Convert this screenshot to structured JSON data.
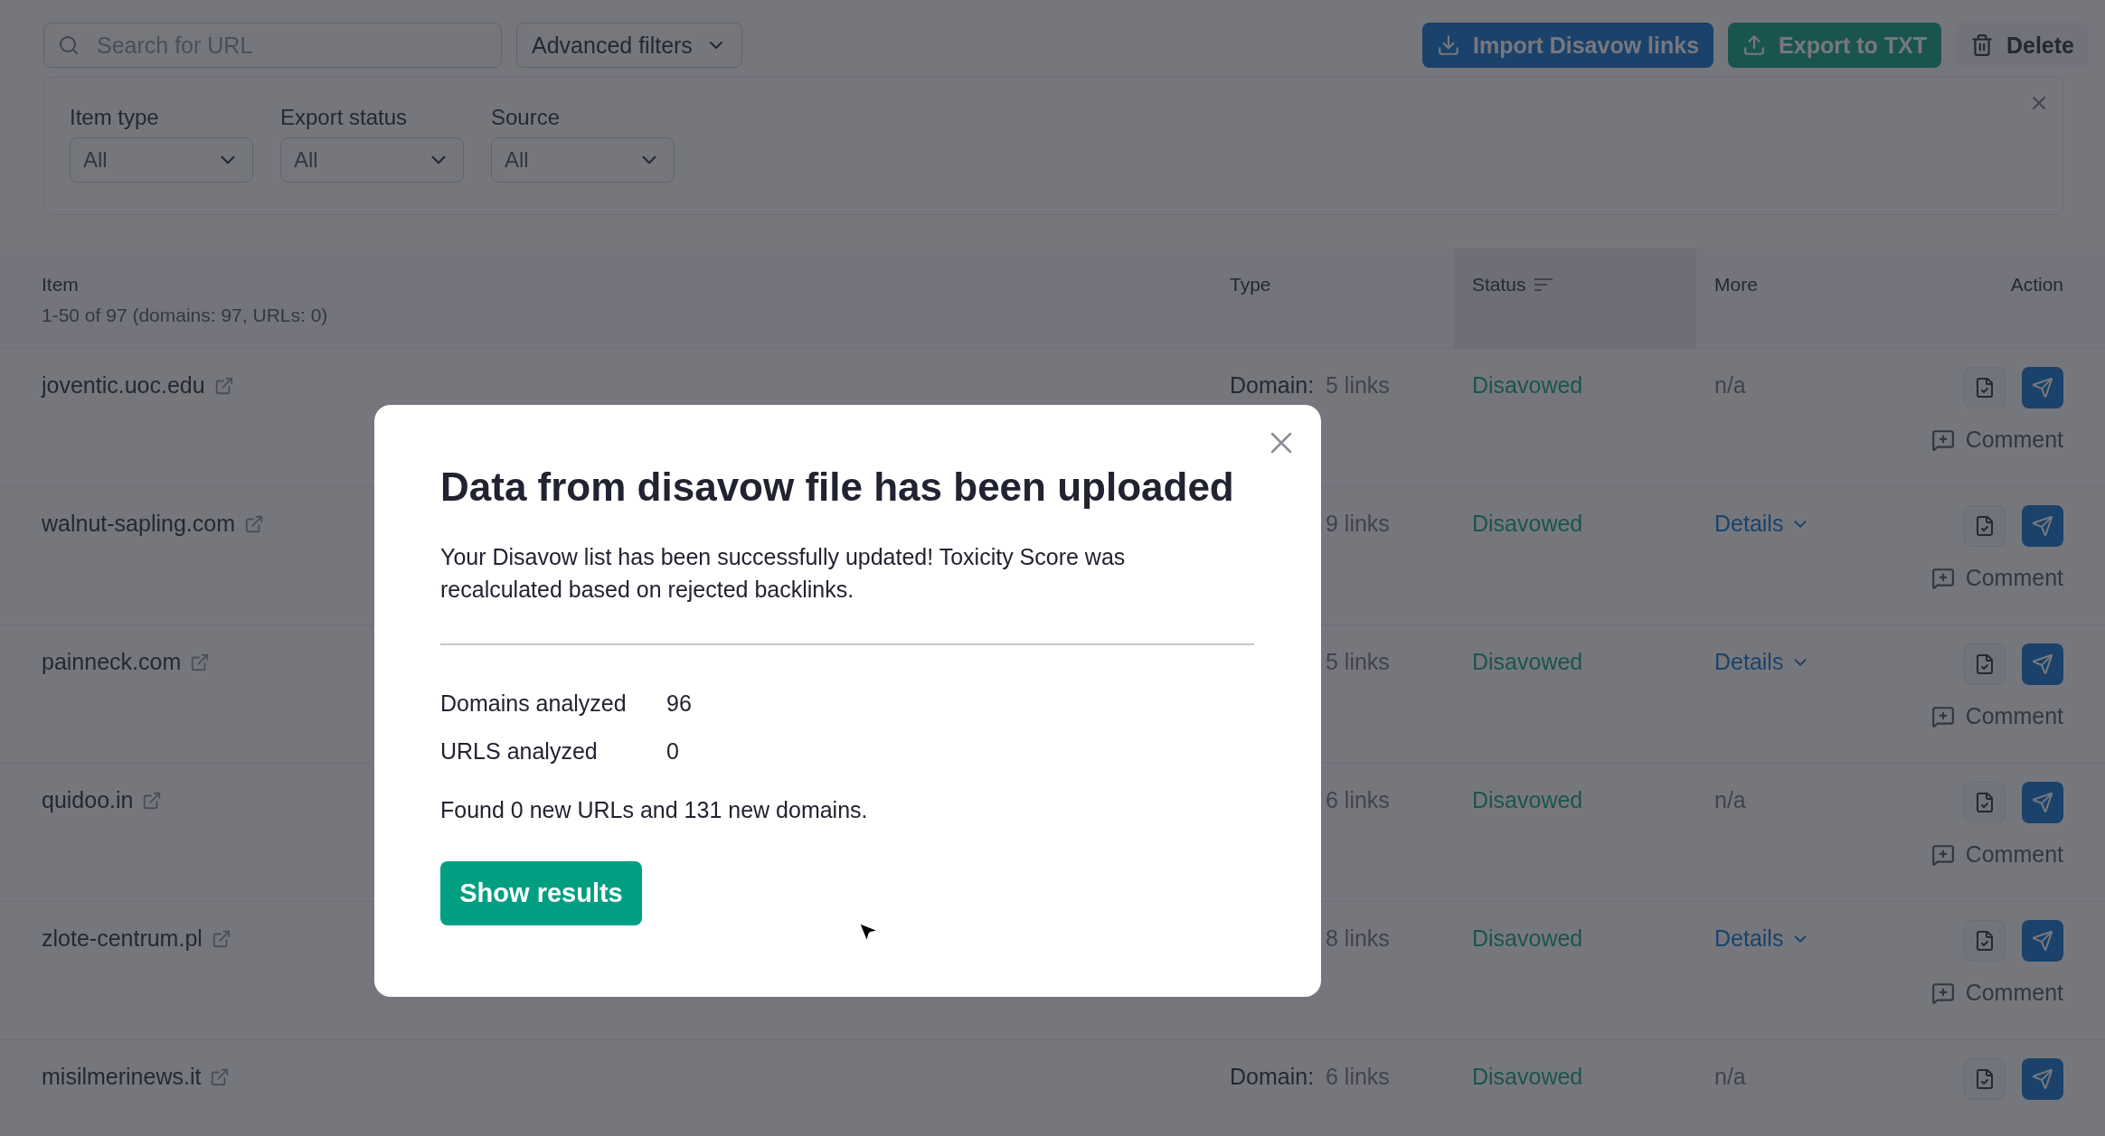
{
  "toolbar": {
    "search": {
      "placeholder": "Search for URL"
    },
    "advanced_filters": "Advanced filters",
    "buttons": [
      {
        "kind": "import",
        "label": "Import Disavow links"
      },
      {
        "kind": "export",
        "label": "Export to TXT"
      },
      {
        "kind": "delete",
        "label": "Delete"
      }
    ]
  },
  "filters": [
    {
      "label": "Item type",
      "value": "All"
    },
    {
      "label": "Export status",
      "value": "All"
    },
    {
      "label": "Source",
      "value": "All"
    }
  ],
  "table": {
    "columns": [
      {
        "label": "Item",
        "sub": "1-50 of 97 (domains: 97, URLs: 0)",
        "sorted": false
      },
      {
        "label": "Type",
        "sorted": false
      },
      {
        "label": "Status",
        "sorted": true
      },
      {
        "label": "More",
        "sorted": false
      },
      {
        "label": "Action",
        "sorted": false
      }
    ],
    "rows": [
      {
        "item": "joventic.uoc.edu",
        "type_label": "Domain:",
        "type_value": "5 links",
        "status": "Disavowed",
        "more": {
          "kind": "na",
          "text": "n/a"
        },
        "comment": "Comment"
      },
      {
        "item": "walnut-sapling.com",
        "type_value": "9 links",
        "status": "Disavowed",
        "more": {
          "kind": "details",
          "text": "Details"
        },
        "comment": "Comment"
      },
      {
        "item": "painneck.com",
        "type_value": "5 links",
        "status": "Disavowed",
        "more": {
          "kind": "details",
          "text": "Details"
        },
        "comment": "Comment"
      },
      {
        "item": "quidoo.in",
        "type_value": "6 links",
        "status": "Disavowed",
        "more": {
          "kind": "na",
          "text": "n/a"
        },
        "comment": "Comment"
      },
      {
        "item": "zlote-centrum.pl",
        "type_value": "8 links",
        "status": "Disavowed",
        "more": {
          "kind": "details",
          "text": "Details"
        },
        "comment": "Comment"
      },
      {
        "item": "misilmerinews.it",
        "type_label": "Domain:",
        "type_value": "6 links",
        "status": "Disavowed",
        "more": {
          "kind": "na",
          "text": "n/a"
        }
      }
    ]
  },
  "modal": {
    "title": "Data from disavow file has been uploaded",
    "message": "Your Disavow list has been successfully updated! Toxicity Score was recalculated based on rejected backlinks.",
    "stats": [
      {
        "label": "Domains analyzed",
        "value": "96"
      },
      {
        "label": "URLS analyzed",
        "value": "0"
      }
    ],
    "summary": "Found 0 new URLs and 131 new domains.",
    "button": "Show results"
  }
}
